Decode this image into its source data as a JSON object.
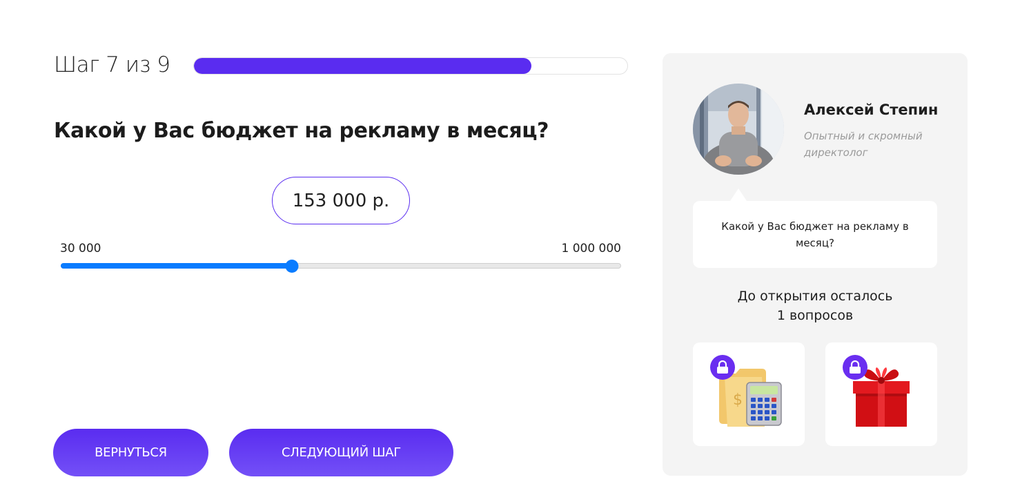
{
  "progress": {
    "step_label": "Шаг 7 из 9",
    "fraction": 0.778,
    "color": "#5a2cf0"
  },
  "quiz": {
    "question": "Какой у Вас бюджет на рекламу в месяц?",
    "value_display": "153 000 р.",
    "slider": {
      "min_label": "30 000",
      "max_label": "1 000 000",
      "min": 30000,
      "max": 1000000,
      "value": 430000,
      "color": "#0a7cff"
    }
  },
  "buttons": {
    "back_label": "ВЕРНУТЬСЯ",
    "next_label": "СЛЕДУЮЩИЙ ШАГ"
  },
  "expert": {
    "name": "Алексей Степин",
    "role": "Опытный и скромный директолог",
    "bubble_text": "Какой у Вас бюджет на рекламу в месяц?"
  },
  "bonuses": {
    "remaining_line1": "До открытия осталось",
    "remaining_line2": "1 вопросов",
    "items": [
      {
        "icon": "calculator-folder-icon",
        "locked": true
      },
      {
        "icon": "gift-box-icon",
        "locked": true
      }
    ]
  }
}
